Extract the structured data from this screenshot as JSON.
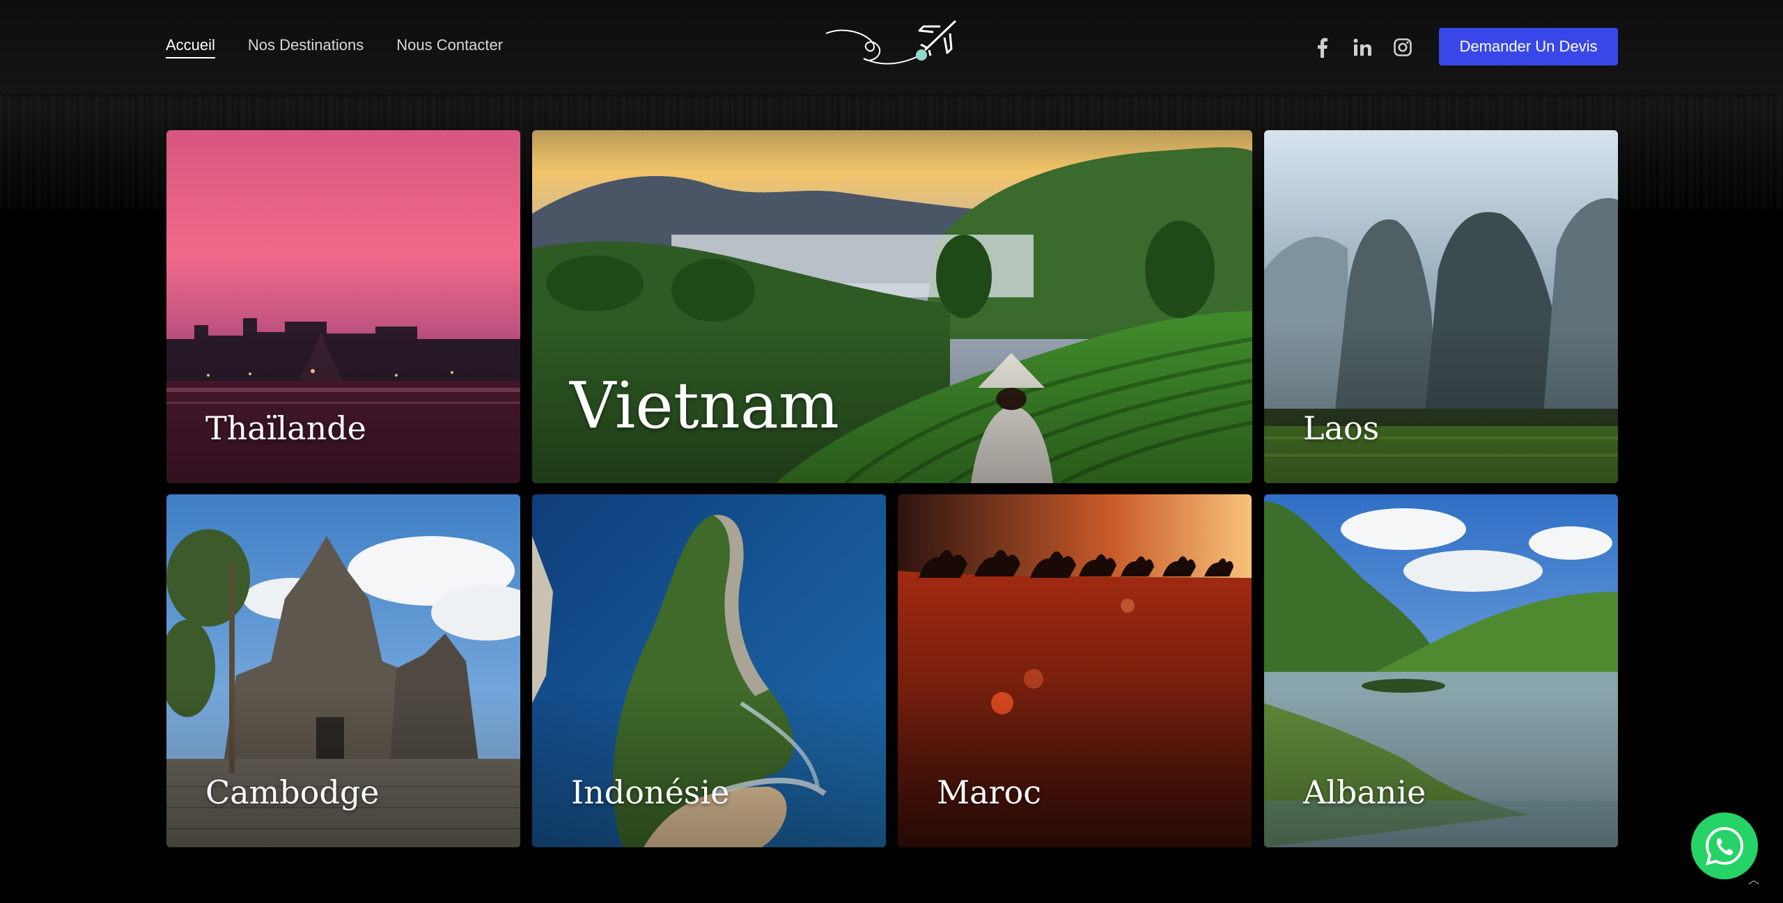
{
  "nav": {
    "items": [
      {
        "label": "Accueil",
        "active": true
      },
      {
        "label": "Nos Destinations",
        "active": false
      },
      {
        "label": "Nous Contacter",
        "active": false
      }
    ]
  },
  "logo": {
    "icon": "airplane-logo-icon"
  },
  "socials": [
    {
      "icon": "facebook-icon"
    },
    {
      "icon": "linkedin-icon"
    },
    {
      "icon": "instagram-icon"
    }
  ],
  "cta": {
    "label": "Demander Un Devis",
    "color": "#3a47e8"
  },
  "destinations": [
    {
      "name": "Thaïlande"
    },
    {
      "name": "Vietnam"
    },
    {
      "name": "Laos"
    },
    {
      "name": "Cambodge"
    },
    {
      "name": "Indonésie"
    },
    {
      "name": "Maroc"
    },
    {
      "name": "Albanie"
    }
  ],
  "whatsapp": {
    "icon": "whatsapp-icon",
    "color": "#25d366"
  },
  "scroll_top": {
    "icon": "chevron-up-icon"
  }
}
